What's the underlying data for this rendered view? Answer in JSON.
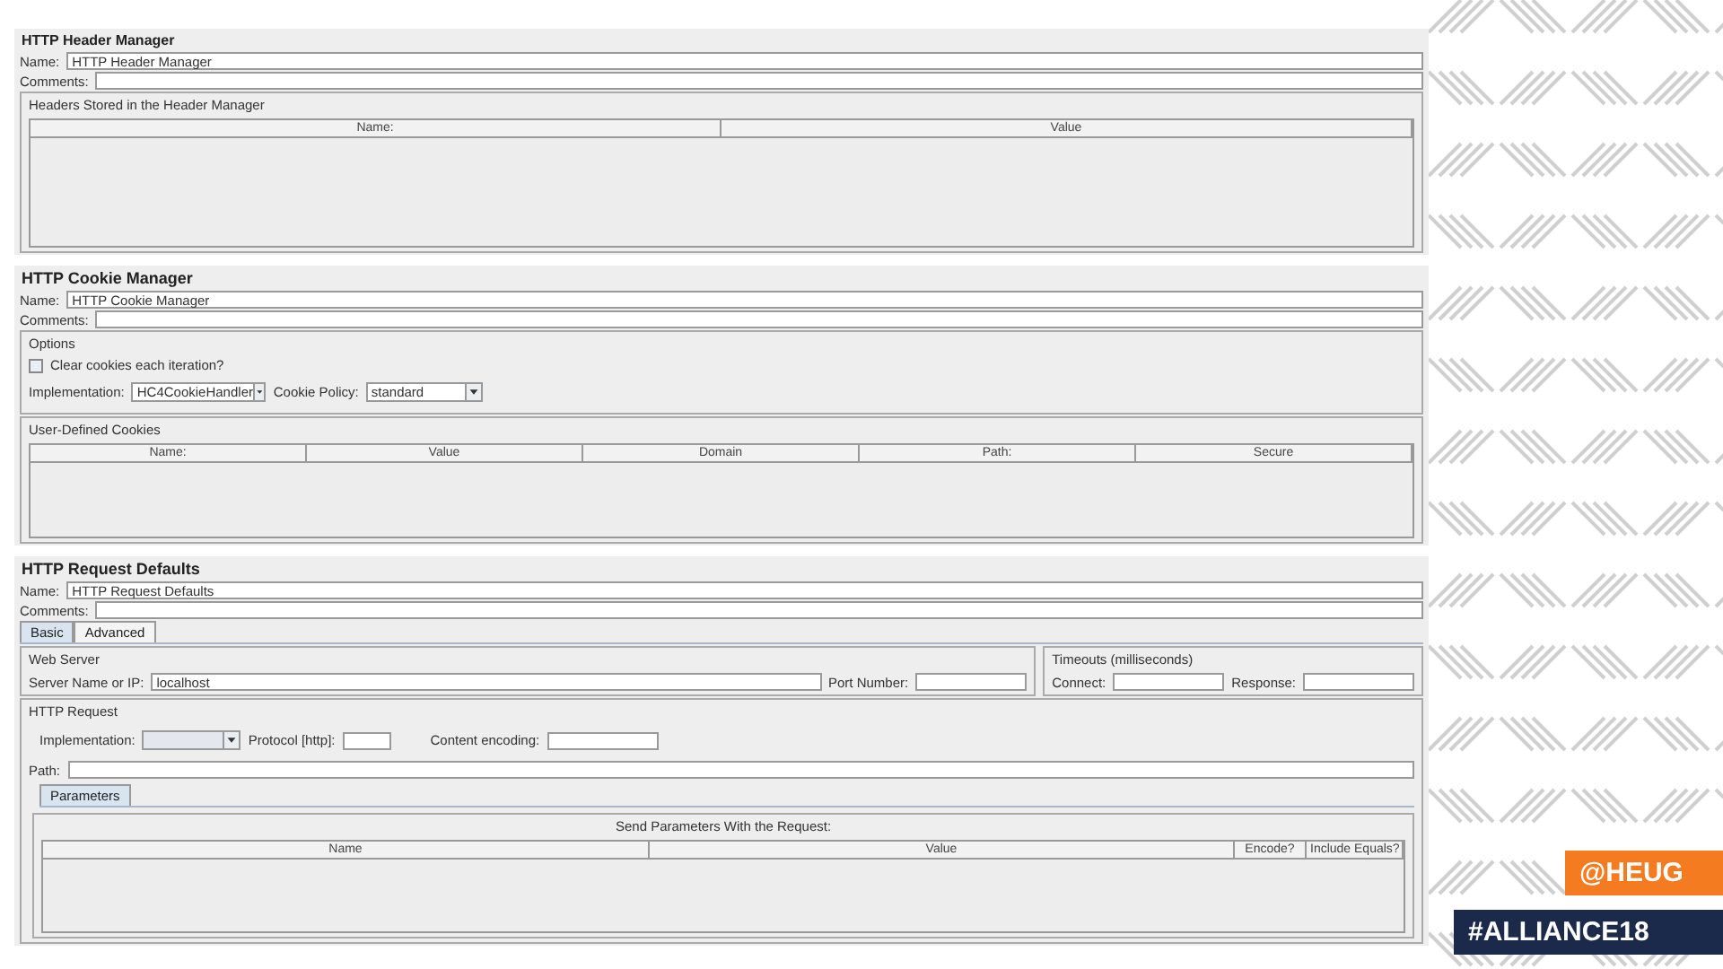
{
  "header_manager": {
    "title": "HTTP Header Manager",
    "name_label": "Name:",
    "name_value": "HTTP Header Manager",
    "comments_label": "Comments:",
    "table_legend": "Headers Stored in the Header Manager",
    "columns": [
      "Name:",
      "Value"
    ]
  },
  "cookie_manager": {
    "title": "HTTP Cookie Manager",
    "name_label": "Name:",
    "name_value": "HTTP Cookie Manager",
    "comments_label": "Comments:",
    "options_legend": "Options",
    "clear_option": {
      "label": "Clear cookies each iteration?",
      "checked": false
    },
    "implementation_label": "Implementation:",
    "implementation_value": "HC4CookieHandler",
    "policy_label": "Cookie Policy:",
    "policy_value": "standard",
    "cookies_legend": "User-Defined Cookies",
    "columns": [
      "Name:",
      "Value",
      "Domain",
      "Path:",
      "Secure"
    ]
  },
  "request_defaults": {
    "title": "HTTP Request Defaults",
    "name_label": "Name:",
    "name_value": "HTTP Request Defaults",
    "comments_label": "Comments:",
    "tabs": [
      {
        "label": "Basic",
        "selected": true
      },
      {
        "label": "Advanced",
        "selected": false
      }
    ],
    "web_server_legend": "Web Server",
    "server_label": "Server Name or IP:",
    "server_value": "localhost",
    "port_label": "Port Number:",
    "timeouts_legend": "Timeouts (milliseconds)",
    "connect_label": "Connect:",
    "response_label": "Response:",
    "http_request_legend": "HTTP Request",
    "implementation_label": "Implementation:",
    "protocol_label": "Protocol [http]:",
    "encoding_label": "Content encoding:",
    "path_label": "Path:",
    "sub_tabs": [
      {
        "label": "Parameters",
        "selected": true
      }
    ],
    "params_caption": "Send Parameters With the Request:",
    "columns": [
      "Name",
      "Value",
      "Encode?",
      "Include Equals?"
    ]
  },
  "badges": [
    {
      "text": "@HEUG",
      "color": "#f47b20"
    },
    {
      "text": "#ALLIANCE18",
      "color": "#1b2a4a"
    }
  ]
}
